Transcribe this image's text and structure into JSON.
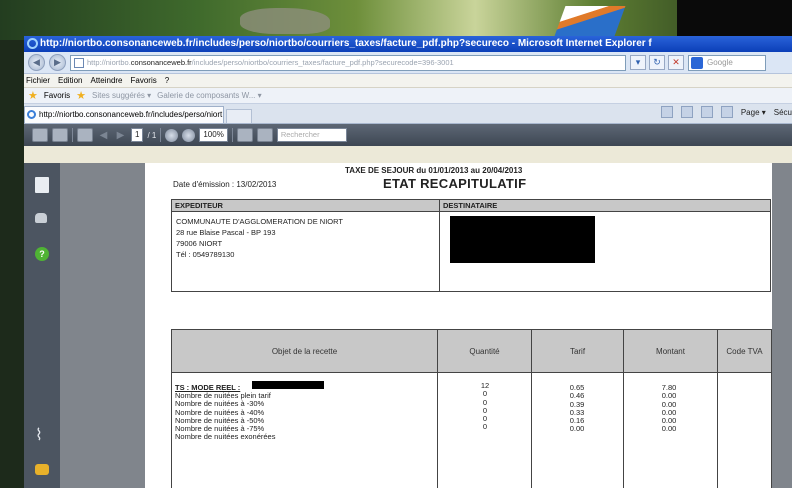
{
  "browser": {
    "title": "http://niortbo.consonanceweb.fr/includes/perso/niortbo/courriers_taxes/facture_pdf.php?secureco - Microsoft Internet Explorer f",
    "address_prefix": "http://niortbo.",
    "address_domain": "consonanceweb.fr",
    "address_path": "/includes/perso/niortbo/courriers_taxes/facture_pdf.php?securecode=396-3001",
    "search_placeholder": "Google",
    "menu": [
      "Fichier",
      "Edition",
      "Atteindre",
      "Favoris",
      "?"
    ],
    "favorites_label": "Favoris",
    "fav_item_1": "Sites suggérés ▾",
    "fav_item_2": "Galerie de composants W... ▾",
    "tab_label": "http://niortbo.consonanceweb.fr/includes/perso/niort...",
    "cmd_page": "Page ▾",
    "cmd_secu": "Sécu"
  },
  "pdf_toolbar": {
    "page_field": "1",
    "page_total": "/ 1",
    "zoom": "100%",
    "find_placeholder": "Rechercher"
  },
  "document": {
    "header": "TAXE DE SEJOUR du 01/01/2013 au 20/04/2013",
    "title": "ETAT RECAPITULATIF",
    "date_emission": "Date d'émission : 13/02/2013",
    "expediteur_label": "EXPEDITEUR",
    "destinataire_label": "DESTINATAIRE",
    "expediteur_lines": [
      "COMMUNAUTE D'AGGLOMERATION DE NIORT",
      "28 rue Blaise Pascal - BP 193",
      "79006 NIORT",
      "Tél : 0549789130"
    ],
    "columns": [
      "Objet de la recette",
      "Quantité",
      "Tarif",
      "Montant",
      "Code TVA"
    ],
    "section_label": "TS : MODE REEL :",
    "rows": [
      {
        "label": "Nombre de nuitées plein tarif",
        "quantite": "12",
        "tarif": "0.65",
        "montant": "7.80"
      },
      {
        "label": "Nombre de nuitées à -30%",
        "quantite": "0",
        "tarif": "0.46",
        "montant": "0.00"
      },
      {
        "label": "Nombre de nuitées à -40%",
        "quantite": "0",
        "tarif": "0.39",
        "montant": "0.00"
      },
      {
        "label": "Nombre de nuitées à -50%",
        "quantite": "0",
        "tarif": "0.33",
        "montant": "0.00"
      },
      {
        "label": "Nombre de nuitées à -75%",
        "quantite": "0",
        "tarif": "0.16",
        "montant": "0.00"
      },
      {
        "label": "Nombre de nuitées exonérées",
        "quantite": "0",
        "tarif": "0.00",
        "montant": "0.00"
      }
    ]
  }
}
